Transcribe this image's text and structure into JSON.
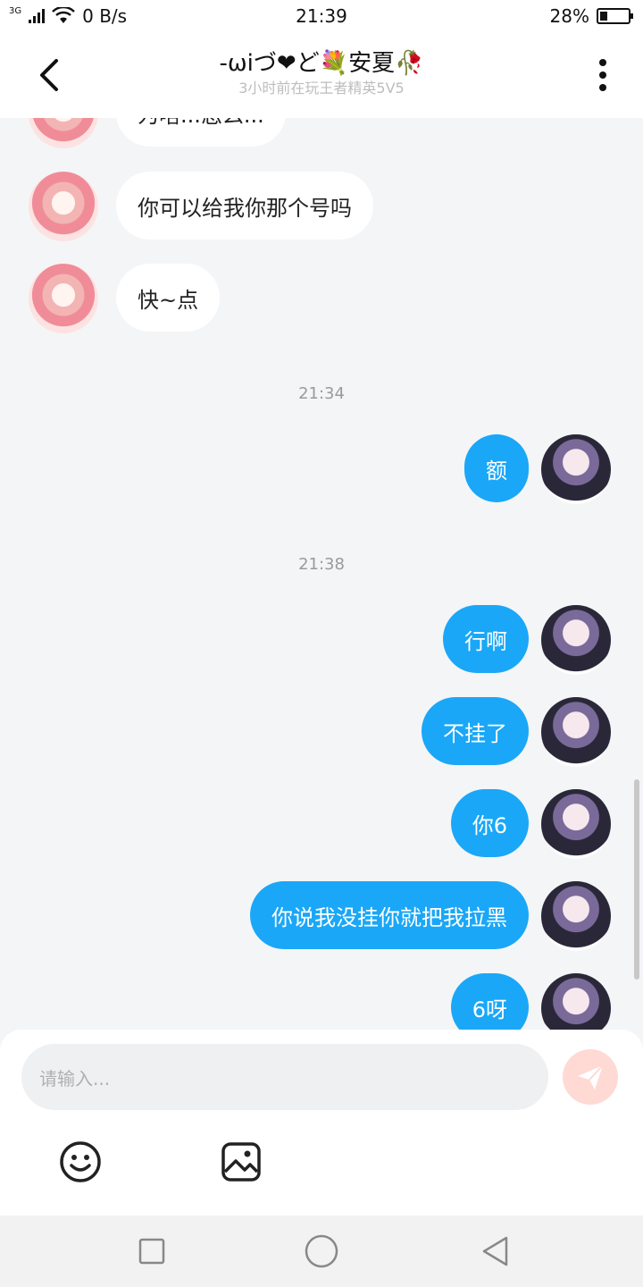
{
  "status_bar": {
    "network_type": "3G",
    "speed": "0 B/s",
    "time": "21:39",
    "battery_percent": "28%",
    "battery_level": 0.28
  },
  "header": {
    "title": "-ωiづ❤ど💐安夏🥀",
    "subtitle": "3小时前在玩王者精英5V5"
  },
  "messages": [
    {
      "side": "in",
      "text": "为啥...怎么..."
    },
    {
      "side": "in",
      "text": "你可以给我你那个号吗"
    },
    {
      "side": "in",
      "text": "快~点"
    },
    {
      "type": "time",
      "text": "21:34"
    },
    {
      "side": "out",
      "text": "额"
    },
    {
      "type": "time",
      "text": "21:38"
    },
    {
      "side": "out",
      "text": "行啊"
    },
    {
      "side": "out",
      "text": "不挂了"
    },
    {
      "side": "out",
      "text": "你6"
    },
    {
      "side": "out",
      "text": "你说我没挂你就把我拉黑"
    },
    {
      "side": "out",
      "text": "6呀"
    }
  ],
  "input": {
    "placeholder": "请输入..."
  },
  "icons": {
    "back": "chevron-left-icon",
    "more": "more-vertical-icon",
    "send": "send-icon",
    "emoji": "emoji-icon",
    "image": "image-icon"
  },
  "colors": {
    "outgoing_bubble": "#1aa7f7",
    "incoming_bubble": "#ffffff",
    "send_button": "#ffd9d4"
  }
}
